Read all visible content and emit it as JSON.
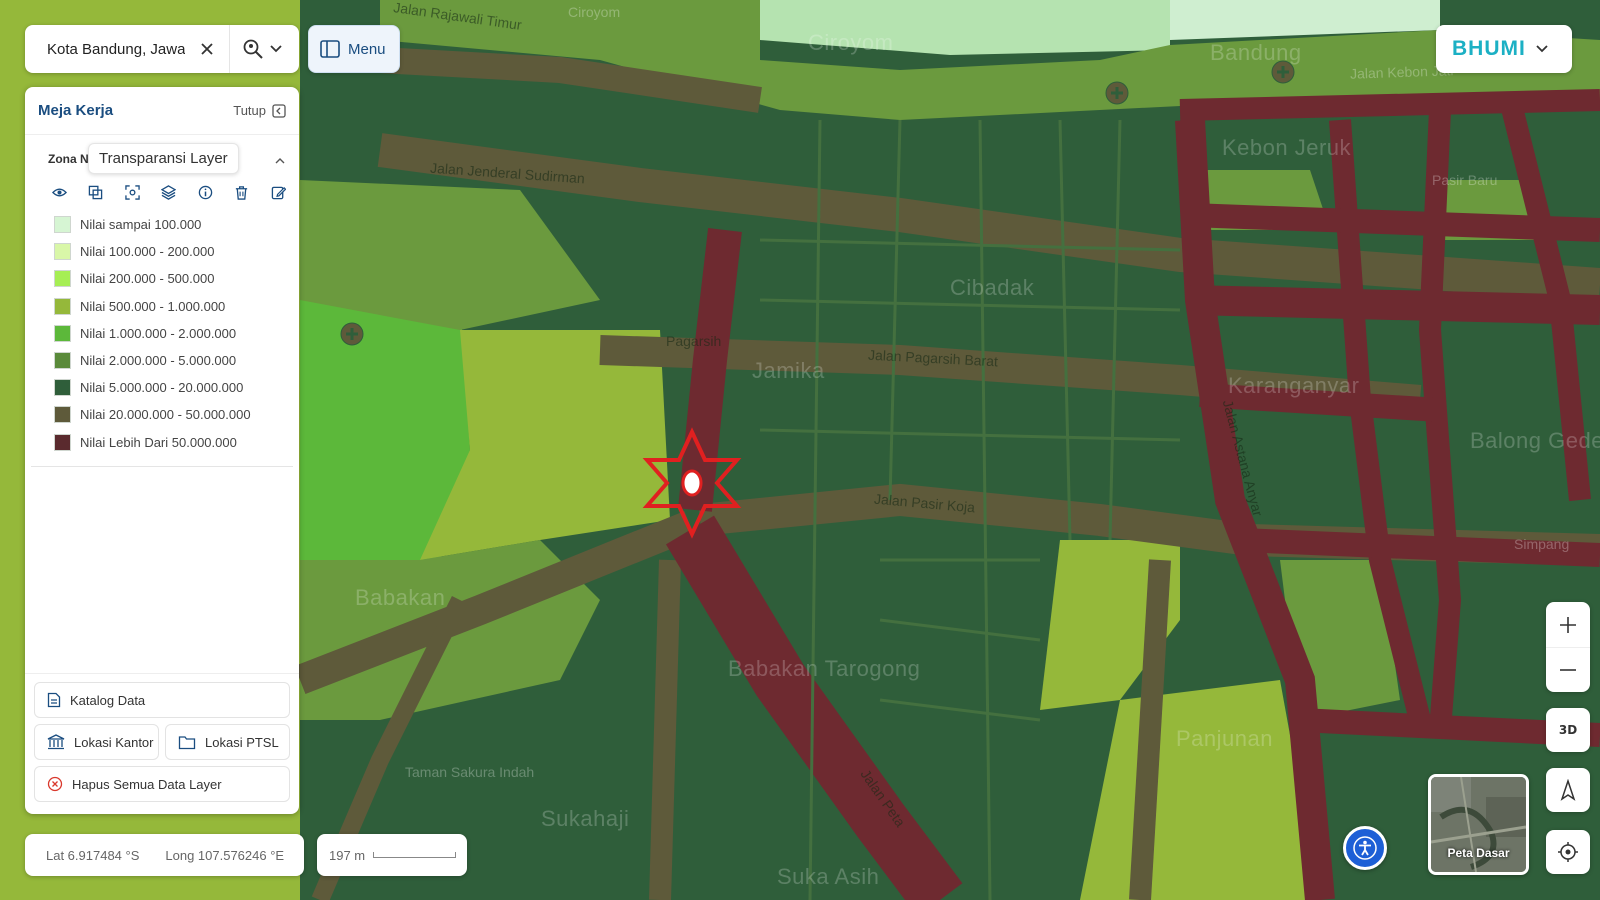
{
  "search": {
    "value": "Kota Bandung, Jawa Barat"
  },
  "menu": {
    "label": "Menu"
  },
  "brand": {
    "name": "BHUMI"
  },
  "workspace": {
    "title": "Meja Kerja",
    "close_label": "Tutup",
    "layer_name": "Zona Nilai Tanah",
    "tooltip": "Transparansi Layer",
    "tools": [
      "eye-icon",
      "copy-icon",
      "focus-icon",
      "layers-icon",
      "info-icon",
      "trash-icon",
      "edit-icon"
    ],
    "legend": [
      {
        "label": "Nilai sampai 100.000",
        "color": "#d6f5d3"
      },
      {
        "label": "Nilai 100.000 - 200.000",
        "color": "#d9f7a8"
      },
      {
        "label": "Nilai 200.000 - 500.000",
        "color": "#a6ee54"
      },
      {
        "label": "Nilai 500.000 - 1.000.000",
        "color": "#95b83a"
      },
      {
        "label": "Nilai 1.000.000 - 2.000.000",
        "color": "#5cb83a"
      },
      {
        "label": "Nilai 2.000.000 - 5.000.000",
        "color": "#5a8a3a"
      },
      {
        "label": "Nilai 5.000.000 - 20.000.000",
        "color": "#2f5e3a"
      },
      {
        "label": "Nilai 20.000.000 - 50.000.000",
        "color": "#5e5a3a"
      },
      {
        "label": "Nilai Lebih Dari 50.000.000",
        "color": "#5a2a2e"
      }
    ],
    "actions": {
      "katalog": "Katalog Data",
      "kantor": "Lokasi Kantor",
      "ptsl": "Lokasi PTSL",
      "hapus": "Hapus Semua Data Layer"
    }
  },
  "status": {
    "lat": "Lat 6.917484 °S",
    "long": "Long 107.576246 °E",
    "scale": "197 m"
  },
  "controls": {
    "btn3d": "3D",
    "basemap": "Peta Dasar"
  },
  "map": {
    "marker_label": "0",
    "place_labels": [
      "Ciroyom",
      "Bandung",
      "Kebon Jeruk",
      "Jamika",
      "Cibadak",
      "Jalan Pagarsih Barat",
      "Jalan Pasir Koja",
      "Karanganyar",
      "Balong Gede",
      "Babakan Tarogong",
      "Babakan",
      "Panjunan",
      "Suka Asih",
      "Sukahaji",
      "Taman Sakura Indah",
      "Jalan Peta",
      "Jalan Jenderal Sudirman",
      "Jalan Rajawali Timur",
      "Jalan Kebon Jati",
      "Pasir Baru",
      "Jalan Astana Anyar",
      "Simpang",
      "Ciroyom",
      "Pagarsih"
    ]
  }
}
